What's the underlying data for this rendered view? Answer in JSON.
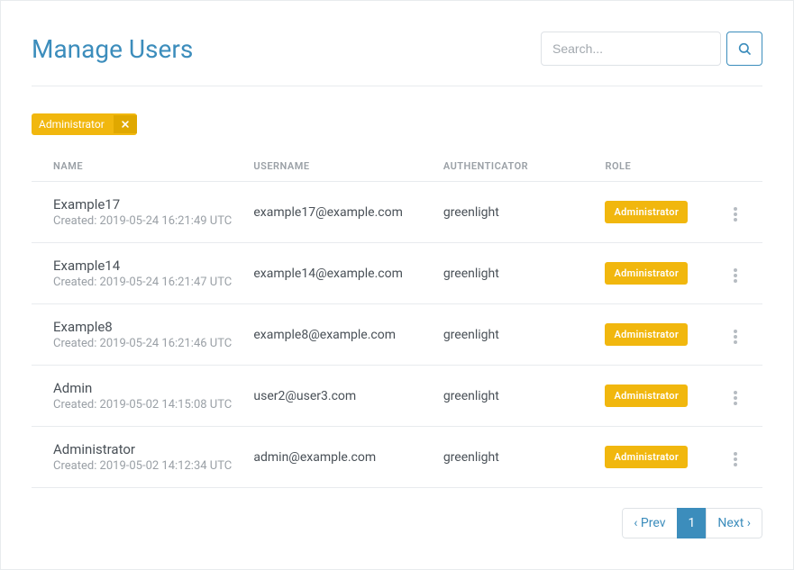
{
  "title": "Manage Users",
  "search": {
    "placeholder": "Search..."
  },
  "filter": {
    "label": "Administrator"
  },
  "columns": {
    "name": "NAME",
    "username": "USERNAME",
    "authenticator": "AUTHENTICATOR",
    "role": "ROLE"
  },
  "created_prefix": "Created: ",
  "users": [
    {
      "name": "Example17",
      "created": "2019-05-24 16:21:49 UTC",
      "username": "example17@example.com",
      "authenticator": "greenlight",
      "role": "Administrator"
    },
    {
      "name": "Example14",
      "created": "2019-05-24 16:21:47 UTC",
      "username": "example14@example.com",
      "authenticator": "greenlight",
      "role": "Administrator"
    },
    {
      "name": "Example8",
      "created": "2019-05-24 16:21:46 UTC",
      "username": "example8@example.com",
      "authenticator": "greenlight",
      "role": "Administrator"
    },
    {
      "name": "Admin",
      "created": "2019-05-02 14:15:08 UTC",
      "username": "user2@user3.com",
      "authenticator": "greenlight",
      "role": "Administrator"
    },
    {
      "name": "Administrator",
      "created": "2019-05-02 14:12:34 UTC",
      "username": "admin@example.com",
      "authenticator": "greenlight",
      "role": "Administrator"
    }
  ],
  "pagination": {
    "prev": "‹ Prev",
    "next": "Next ›",
    "current": "1"
  }
}
